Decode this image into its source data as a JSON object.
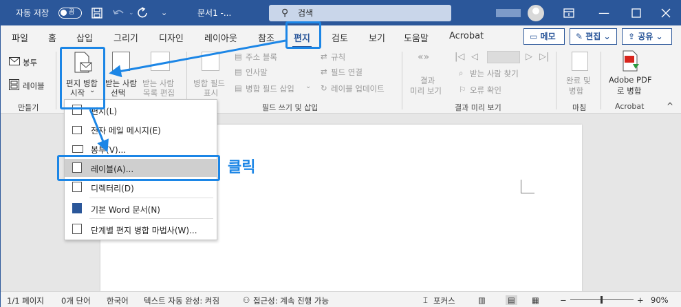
{
  "titlebar": {
    "autosave_label": "자동 저장",
    "autosave_state": "끔",
    "doc_title": "문서1  -...",
    "search_placeholder": "검색"
  },
  "tabs": [
    {
      "label": "파일"
    },
    {
      "label": "홈"
    },
    {
      "label": "삽입"
    },
    {
      "label": "그리기"
    },
    {
      "label": "디자인"
    },
    {
      "label": "레이아웃"
    },
    {
      "label": "참조"
    },
    {
      "label": "편지"
    },
    {
      "label": "검토"
    },
    {
      "label": "보기"
    },
    {
      "label": "도움말"
    },
    {
      "label": "Acrobat"
    }
  ],
  "tab_buttons": {
    "memo": "메모",
    "edit": "편집",
    "share": "공유"
  },
  "ribbon": {
    "envelope": "봉투",
    "labels": "레이블",
    "group_create": "만들기",
    "start_merge": [
      "편지 병합",
      "시작"
    ],
    "select_recipients": [
      "받는 사람",
      "선택"
    ],
    "edit_recipients": [
      "받는 사람",
      "목록 편집"
    ],
    "highlight_fields": [
      "병합 필드",
      "표시"
    ],
    "address_block": "주소 블록",
    "greeting": "인사말",
    "insert_field": "병합 필드 삽입",
    "rules": "규칙",
    "match_fields": "필드 연결",
    "update_labels": "레이블 업데이트",
    "group_fields": "필드 쓰기 및 삽입",
    "preview_results": [
      "결과",
      "미리 보기"
    ],
    "find_recipient": "받는 사람 찾기",
    "check_errors": "오류 확인",
    "group_preview": "결과 미리 보기",
    "finish_merge": [
      "완료 및",
      "병합"
    ],
    "group_finish": "마침",
    "adobe_pdf": [
      "Adobe PDF",
      "로 병합"
    ],
    "group_acrobat": "Acrobat"
  },
  "dropdown": {
    "items": [
      {
        "label": "편지(L)"
      },
      {
        "label": "전자 메일 메시지(E)"
      },
      {
        "label": "봉투(V)..."
      },
      {
        "label": "레이블(A)..."
      },
      {
        "label": "디렉터리(D)"
      },
      {
        "label": "기본 Word 문서(N)"
      },
      {
        "label": "단계별 편지 병합 마법사(W)..."
      }
    ]
  },
  "callout": "클릭",
  "status": {
    "page": "1/1 페이지",
    "words": "0개 단어",
    "language": "한국어",
    "autocomplete": "텍스트 자동 완성: 켜짐",
    "accessibility": "접근성: 계속 진행 가능",
    "focus": "포커스",
    "zoom": "90%"
  },
  "colors": {
    "accent": "#2b579a",
    "highlight": "#1c86e6"
  }
}
